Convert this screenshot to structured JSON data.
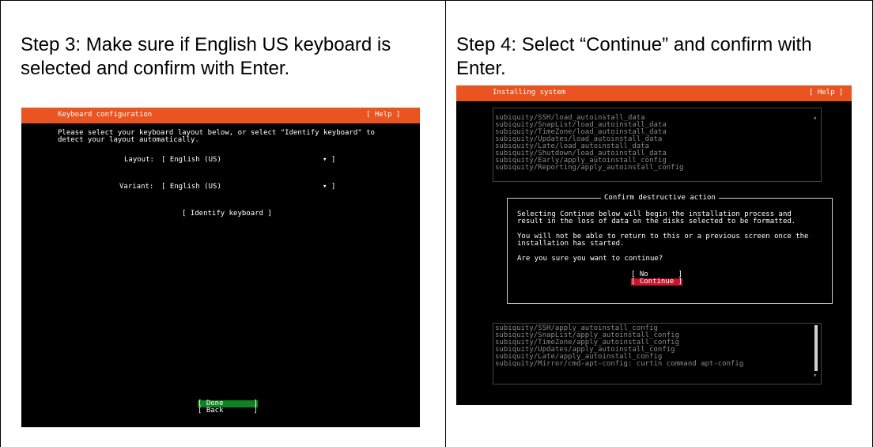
{
  "left_cell": {
    "caption": "Step 3: Make sure if English US keyboard is selected and confirm with Enter.",
    "caption_line1": "Step 3: Make sure if English US keyboard is",
    "caption_line2": "selected and confirm with Enter.",
    "screen": {
      "title": "Keyboard configuration",
      "help": "[ Help ]",
      "intro_line1": "Please select your keyboard layout below, or select \"Identify keyboard\" to",
      "intro_line2": "detect your layout automatically.",
      "layout_label": "Layout:",
      "layout_value": "[ English (US)",
      "layout_arrow": "▾ ]",
      "variant_label": "Variant:",
      "variant_value": "[ English (US)",
      "variant_arrow": "▾ ]",
      "identify_button": "[ Identify keyboard ]",
      "done_button": "[ Done       ]",
      "back_button": "[ Back       ]",
      "header_color": "#e95420",
      "done_color": "#0e8420"
    }
  },
  "right_cell": {
    "caption_line1": "Step 4: Select “Continue” and confirm with",
    "caption_line2": "Enter.",
    "screen": {
      "title": "Installing system",
      "help": "[ Help ]",
      "log_top": [
        "subiquity/SSH/load_autoinstall_data",
        "subiquity/SnapList/load_autoinstall_data",
        "subiquity/TimeZone/load_autoinstall_data",
        "subiquity/Updates/load_autoinstall_data",
        "subiquity/Late/load_autoinstall_data",
        "subiquity/Shutdown/load_autoinstall_data",
        "subiquity/Early/apply_autoinstall_config",
        "subiquity/Reporting/apply_autoinstall_config"
      ],
      "dialog_title": "Confirm destructive action",
      "dialog_p1_line1": "Selecting Continue below will begin the installation process and",
      "dialog_p1_line2": "result in the loss of data on the disks selected to be formatted.",
      "dialog_p2_line1": "You will not be able to return to this or a previous screen once the",
      "dialog_p2_line2": "installation has started.",
      "dialog_question": "Are you sure you want to continue?",
      "no_button": "[ No       ]",
      "continue_button": "[ Continue ]",
      "log_bottom": [
        "subiquity/SSH/apply_autoinstall_config",
        "subiquity/SnapList/apply_autoinstall_config",
        "subiquity/TimeZone/apply_autoinstall_config",
        "subiquity/Updates/apply_autoinstall_config",
        "subiquity/Late/apply_autoinstall_config",
        "subiquity/Mirror/cmd-apt-config: curtin command apt-config"
      ],
      "header_color": "#e95420",
      "continue_color": "#c7162b"
    }
  }
}
